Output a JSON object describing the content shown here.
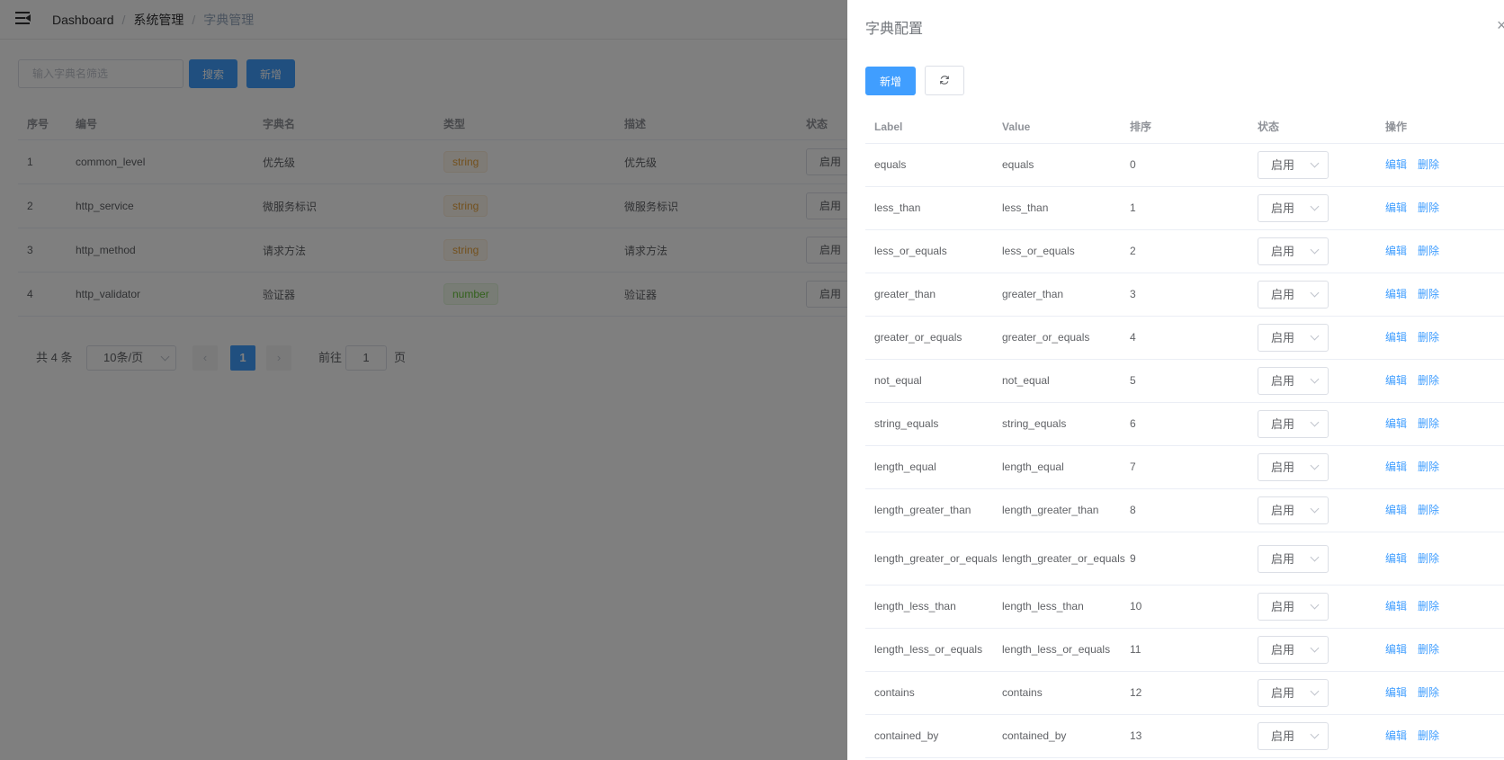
{
  "navbar": {
    "breadcrumb": [
      "Dashboard",
      "系统管理",
      "字典管理"
    ]
  },
  "toolbar": {
    "search_placeholder": "输入字典名筛选",
    "search_label": "搜索",
    "add_label": "新增"
  },
  "dict_table": {
    "headers": [
      "序号",
      "编号",
      "字典名",
      "类型",
      "描述",
      "状态"
    ],
    "rows": [
      {
        "index": "1",
        "code": "common_level",
        "name": "优先级",
        "type": "string",
        "desc": "优先级",
        "status": "启用"
      },
      {
        "index": "2",
        "code": "http_service",
        "name": "微服务标识",
        "type": "string",
        "desc": "微服务标识",
        "status": "启用"
      },
      {
        "index": "3",
        "code": "http_method",
        "name": "请求方法",
        "type": "string",
        "desc": "请求方法",
        "status": "启用"
      },
      {
        "index": "4",
        "code": "http_validator",
        "name": "验证器",
        "type": "number",
        "desc": "验证器",
        "status": "启用"
      }
    ]
  },
  "pagination": {
    "total": "共 4 条",
    "page_size": "10条/页",
    "prev": "‹",
    "current": "1",
    "next": "›",
    "goto_prefix": "前往",
    "goto_value": "1",
    "goto_suffix": "页"
  },
  "drawer": {
    "title": "字典配置",
    "close": "×",
    "add_label": "新增",
    "headers": [
      "Label",
      "Value",
      "排序",
      "状态",
      "操作"
    ],
    "edit_label": "编辑",
    "delete_label": "删除",
    "rows": [
      {
        "label": "equals",
        "value": "equals",
        "sort": "0",
        "status": "启用"
      },
      {
        "label": "less_than",
        "value": "less_than",
        "sort": "1",
        "status": "启用"
      },
      {
        "label": "less_or_equals",
        "value": "less_or_equals",
        "sort": "2",
        "status": "启用"
      },
      {
        "label": "greater_than",
        "value": "greater_than",
        "sort": "3",
        "status": "启用"
      },
      {
        "label": "greater_or_equals",
        "value": "greater_or_equals",
        "sort": "4",
        "status": "启用"
      },
      {
        "label": "not_equal",
        "value": "not_equal",
        "sort": "5",
        "status": "启用"
      },
      {
        "label": "string_equals",
        "value": "string_equals",
        "sort": "6",
        "status": "启用"
      },
      {
        "label": "length_equal",
        "value": "length_equal",
        "sort": "7",
        "status": "启用"
      },
      {
        "label": "length_greater_than",
        "value": "length_greater_than",
        "sort": "8",
        "status": "启用"
      },
      {
        "label": "length_greater_or_equals",
        "value": "length_greater_or_equals",
        "sort": "9",
        "status": "启用"
      },
      {
        "label": "length_less_than",
        "value": "length_less_than",
        "sort": "10",
        "status": "启用"
      },
      {
        "label": "length_less_or_equals",
        "value": "length_less_or_equals",
        "sort": "11",
        "status": "启用"
      },
      {
        "label": "contains",
        "value": "contains",
        "sort": "12",
        "status": "启用"
      },
      {
        "label": "contained_by",
        "value": "contained_by",
        "sort": "13",
        "status": "启用"
      }
    ]
  },
  "colors": {
    "primary": "#409eff",
    "overlay": "rgba(0,0,0,0.5)",
    "tag_string": "#e6a23c",
    "tag_number": "#67c23a"
  }
}
